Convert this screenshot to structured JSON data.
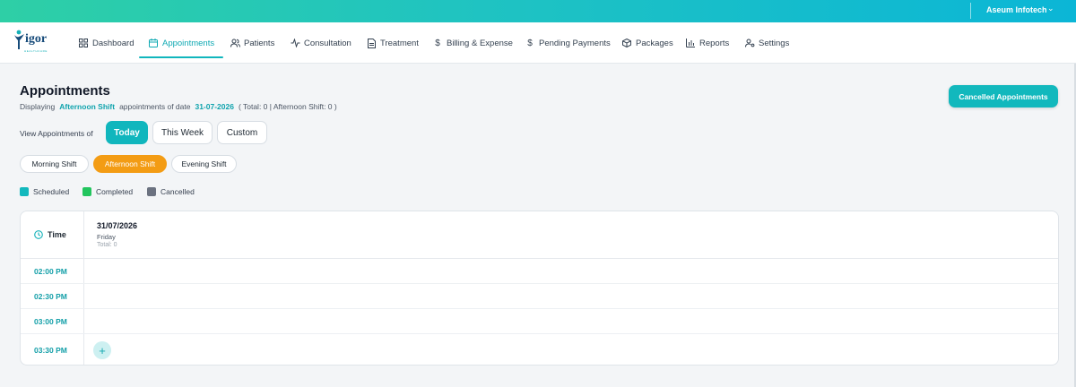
{
  "topbar": {
    "org_name": "Aseum Infotech",
    "org_chevron": "⌄"
  },
  "logo": {
    "word": "igor",
    "tagline": "HEALTHCARE"
  },
  "nav": {
    "items": [
      {
        "label": "Dashboard",
        "icon": "grid-icon",
        "active": false
      },
      {
        "label": "Appointments",
        "icon": "calendar-icon",
        "active": true
      },
      {
        "label": "Patients",
        "icon": "users-icon",
        "active": false
      },
      {
        "label": "Consultation",
        "icon": "activity-icon",
        "active": false
      },
      {
        "label": "Treatment",
        "icon": "document-icon",
        "active": false
      },
      {
        "label": "Billing & Expense",
        "icon": "dollar-icon",
        "active": false
      },
      {
        "label": "Pending Payments",
        "icon": "dollar-icon",
        "active": false
      },
      {
        "label": "Packages",
        "icon": "package-icon",
        "active": false
      },
      {
        "label": "Reports",
        "icon": "bar-chart-icon",
        "active": false
      },
      {
        "label": "Settings",
        "icon": "user-cog-icon",
        "active": false
      }
    ]
  },
  "page": {
    "title": "Appointments",
    "subtitle": {
      "prefix": "Displaying",
      "shift": "Afternoon Shift",
      "middle": "appointments of date",
      "date": "31-07-2026",
      "summary": "( Total: 0 | Afternoon Shift: 0 )"
    },
    "cancelled_button": "Cancelled Appointments"
  },
  "view": {
    "label": "View Appointments of",
    "ranges": [
      {
        "label": "Today",
        "active": true
      },
      {
        "label": "This Week",
        "active": false
      },
      {
        "label": "Custom",
        "active": false
      }
    ],
    "shifts": [
      {
        "label": "Morning Shift",
        "active": false
      },
      {
        "label": "Afternoon Shift",
        "active": true
      },
      {
        "label": "Evening Shift",
        "active": false
      }
    ]
  },
  "legend": [
    {
      "label": "Scheduled",
      "color": "#12b8bd"
    },
    {
      "label": "Completed",
      "color": "#22c55e"
    },
    {
      "label": "Cancelled",
      "color": "#6b7280"
    }
  ],
  "calendar": {
    "time_header": "Time",
    "day": {
      "date": "31/07/2026",
      "weekday": "Friday",
      "total": "Total: 0"
    },
    "slots": [
      "02:00 PM",
      "02:30 PM",
      "03:00 PM",
      "03:30 PM"
    ],
    "add_symbol": "+"
  },
  "colors": {
    "accent": "#10b6bd",
    "active_shift": "#f39c14"
  }
}
